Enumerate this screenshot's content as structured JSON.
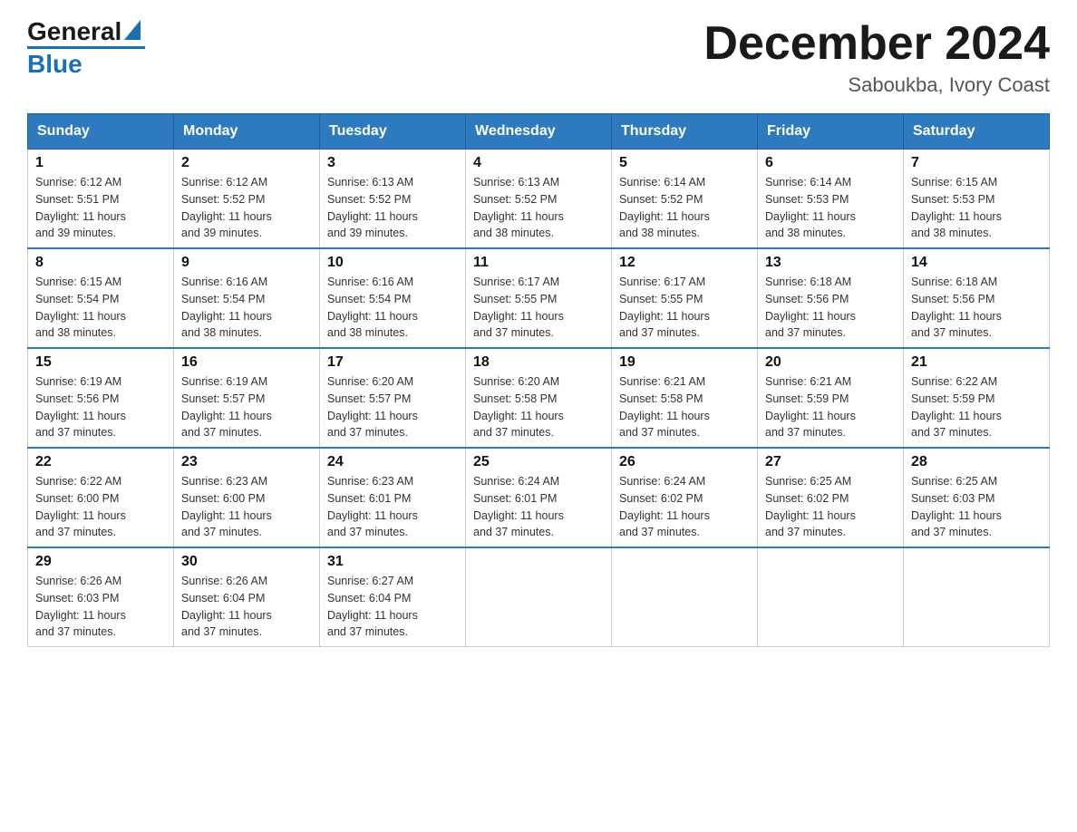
{
  "logo": {
    "general": "General",
    "blue": "Blue"
  },
  "title": "December 2024",
  "subtitle": "Saboukba, Ivory Coast",
  "days_of_week": [
    "Sunday",
    "Monday",
    "Tuesday",
    "Wednesday",
    "Thursday",
    "Friday",
    "Saturday"
  ],
  "weeks": [
    [
      {
        "day": "1",
        "sunrise": "6:12 AM",
        "sunset": "5:51 PM",
        "daylight": "11 hours and 39 minutes."
      },
      {
        "day": "2",
        "sunrise": "6:12 AM",
        "sunset": "5:52 PM",
        "daylight": "11 hours and 39 minutes."
      },
      {
        "day": "3",
        "sunrise": "6:13 AM",
        "sunset": "5:52 PM",
        "daylight": "11 hours and 39 minutes."
      },
      {
        "day": "4",
        "sunrise": "6:13 AM",
        "sunset": "5:52 PM",
        "daylight": "11 hours and 38 minutes."
      },
      {
        "day": "5",
        "sunrise": "6:14 AM",
        "sunset": "5:52 PM",
        "daylight": "11 hours and 38 minutes."
      },
      {
        "day": "6",
        "sunrise": "6:14 AM",
        "sunset": "5:53 PM",
        "daylight": "11 hours and 38 minutes."
      },
      {
        "day": "7",
        "sunrise": "6:15 AM",
        "sunset": "5:53 PM",
        "daylight": "11 hours and 38 minutes."
      }
    ],
    [
      {
        "day": "8",
        "sunrise": "6:15 AM",
        "sunset": "5:54 PM",
        "daylight": "11 hours and 38 minutes."
      },
      {
        "day": "9",
        "sunrise": "6:16 AM",
        "sunset": "5:54 PM",
        "daylight": "11 hours and 38 minutes."
      },
      {
        "day": "10",
        "sunrise": "6:16 AM",
        "sunset": "5:54 PM",
        "daylight": "11 hours and 38 minutes."
      },
      {
        "day": "11",
        "sunrise": "6:17 AM",
        "sunset": "5:55 PM",
        "daylight": "11 hours and 37 minutes."
      },
      {
        "day": "12",
        "sunrise": "6:17 AM",
        "sunset": "5:55 PM",
        "daylight": "11 hours and 37 minutes."
      },
      {
        "day": "13",
        "sunrise": "6:18 AM",
        "sunset": "5:56 PM",
        "daylight": "11 hours and 37 minutes."
      },
      {
        "day": "14",
        "sunrise": "6:18 AM",
        "sunset": "5:56 PM",
        "daylight": "11 hours and 37 minutes."
      }
    ],
    [
      {
        "day": "15",
        "sunrise": "6:19 AM",
        "sunset": "5:56 PM",
        "daylight": "11 hours and 37 minutes."
      },
      {
        "day": "16",
        "sunrise": "6:19 AM",
        "sunset": "5:57 PM",
        "daylight": "11 hours and 37 minutes."
      },
      {
        "day": "17",
        "sunrise": "6:20 AM",
        "sunset": "5:57 PM",
        "daylight": "11 hours and 37 minutes."
      },
      {
        "day": "18",
        "sunrise": "6:20 AM",
        "sunset": "5:58 PM",
        "daylight": "11 hours and 37 minutes."
      },
      {
        "day": "19",
        "sunrise": "6:21 AM",
        "sunset": "5:58 PM",
        "daylight": "11 hours and 37 minutes."
      },
      {
        "day": "20",
        "sunrise": "6:21 AM",
        "sunset": "5:59 PM",
        "daylight": "11 hours and 37 minutes."
      },
      {
        "day": "21",
        "sunrise": "6:22 AM",
        "sunset": "5:59 PM",
        "daylight": "11 hours and 37 minutes."
      }
    ],
    [
      {
        "day": "22",
        "sunrise": "6:22 AM",
        "sunset": "6:00 PM",
        "daylight": "11 hours and 37 minutes."
      },
      {
        "day": "23",
        "sunrise": "6:23 AM",
        "sunset": "6:00 PM",
        "daylight": "11 hours and 37 minutes."
      },
      {
        "day": "24",
        "sunrise": "6:23 AM",
        "sunset": "6:01 PM",
        "daylight": "11 hours and 37 minutes."
      },
      {
        "day": "25",
        "sunrise": "6:24 AM",
        "sunset": "6:01 PM",
        "daylight": "11 hours and 37 minutes."
      },
      {
        "day": "26",
        "sunrise": "6:24 AM",
        "sunset": "6:02 PM",
        "daylight": "11 hours and 37 minutes."
      },
      {
        "day": "27",
        "sunrise": "6:25 AM",
        "sunset": "6:02 PM",
        "daylight": "11 hours and 37 minutes."
      },
      {
        "day": "28",
        "sunrise": "6:25 AM",
        "sunset": "6:03 PM",
        "daylight": "11 hours and 37 minutes."
      }
    ],
    [
      {
        "day": "29",
        "sunrise": "6:26 AM",
        "sunset": "6:03 PM",
        "daylight": "11 hours and 37 minutes."
      },
      {
        "day": "30",
        "sunrise": "6:26 AM",
        "sunset": "6:04 PM",
        "daylight": "11 hours and 37 minutes."
      },
      {
        "day": "31",
        "sunrise": "6:27 AM",
        "sunset": "6:04 PM",
        "daylight": "11 hours and 37 minutes."
      },
      null,
      null,
      null,
      null
    ]
  ]
}
